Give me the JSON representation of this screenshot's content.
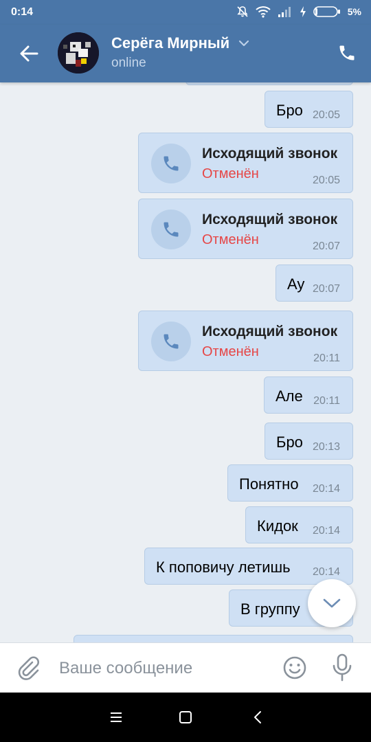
{
  "status_bar": {
    "time": "0:14",
    "battery_percent": "5%",
    "icons": [
      "mute-icon",
      "wifi-icon",
      "signal-icon",
      "charging-icon",
      "battery-icon"
    ]
  },
  "header": {
    "contact_name": "Серёга Мирный",
    "contact_status": "online",
    "icons": [
      "back-arrow-icon",
      "chevron-down-icon",
      "phone-icon"
    ]
  },
  "messages": [
    {
      "type": "text",
      "text": "Бро",
      "time": "20:05"
    },
    {
      "type": "call",
      "title": "Исходящий звонок",
      "status": "Отменён",
      "time": "20:05"
    },
    {
      "type": "call",
      "title": "Исходящий звонок",
      "status": "Отменён",
      "time": "20:07"
    },
    {
      "type": "text",
      "text": "Ау",
      "time": "20:07"
    },
    {
      "type": "call",
      "title": "Исходящий звонок",
      "status": "Отменён",
      "time": "20:11"
    },
    {
      "type": "text",
      "text": "Але",
      "time": "20:11"
    },
    {
      "type": "text",
      "text": "Бро",
      "time": "20:13"
    },
    {
      "type": "text",
      "text": "Понятно",
      "time": "20:14"
    },
    {
      "type": "text",
      "text": "Кидок",
      "time": "20:14"
    },
    {
      "type": "text",
      "text": "К поповичу летишь",
      "time": "20:14"
    },
    {
      "type": "text",
      "text": "В группу",
      "time": ""
    }
  ],
  "composer": {
    "placeholder": "Ваше сообщение",
    "icons": [
      "paperclip-icon",
      "emoji-icon",
      "microphone-icon"
    ]
  },
  "colors": {
    "header_bg": "#4a76a8",
    "bubble_bg": "#cfe0f4",
    "chat_bg": "#ebeff3",
    "cancelled_red": "#e64646"
  }
}
